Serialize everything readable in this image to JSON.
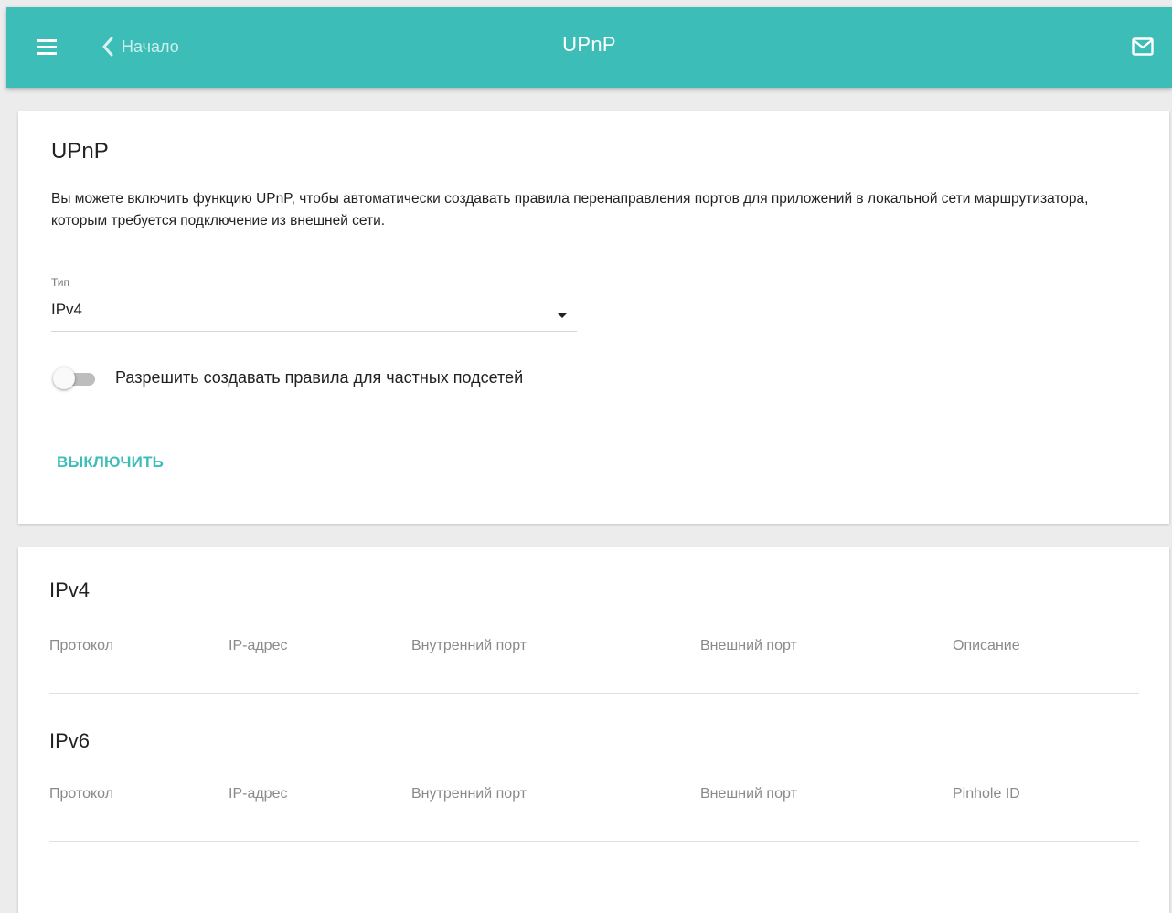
{
  "header": {
    "back_label": "Начало",
    "title": "UPnP",
    "icons": {
      "menu": "hamburger-menu-icon",
      "back": "chevron-left-icon",
      "mail": "envelope-icon"
    },
    "colors": {
      "bar": "#3dbdb8",
      "text": "#ffffff"
    }
  },
  "upnp": {
    "title": "UPnP",
    "description": "Вы можете включить функцию UPnP, чтобы автоматически создавать правила перенаправления портов для приложений в локальной сети маршрутизатора, которым требуется подключение из внешней сети.",
    "type_label": "Тип",
    "type_value": "IPv4",
    "private_subnets_label": "Разрешить создавать правила для частных подсетей",
    "private_subnets_enabled": false,
    "toggle_action": "ВЫКЛЮЧИТЬ",
    "accent_color": "#3dbdb8"
  },
  "tables": {
    "ipv4": {
      "title": "IPv4",
      "columns": [
        "Протокол",
        "IP-адрес",
        "Внутренний порт",
        "Внешний порт",
        "Описание"
      ],
      "rows": []
    },
    "ipv6": {
      "title": "IPv6",
      "columns": [
        "Протокол",
        "IP-адрес",
        "Внутренний порт",
        "Внешний порт",
        "Pinhole ID"
      ],
      "rows": []
    }
  }
}
